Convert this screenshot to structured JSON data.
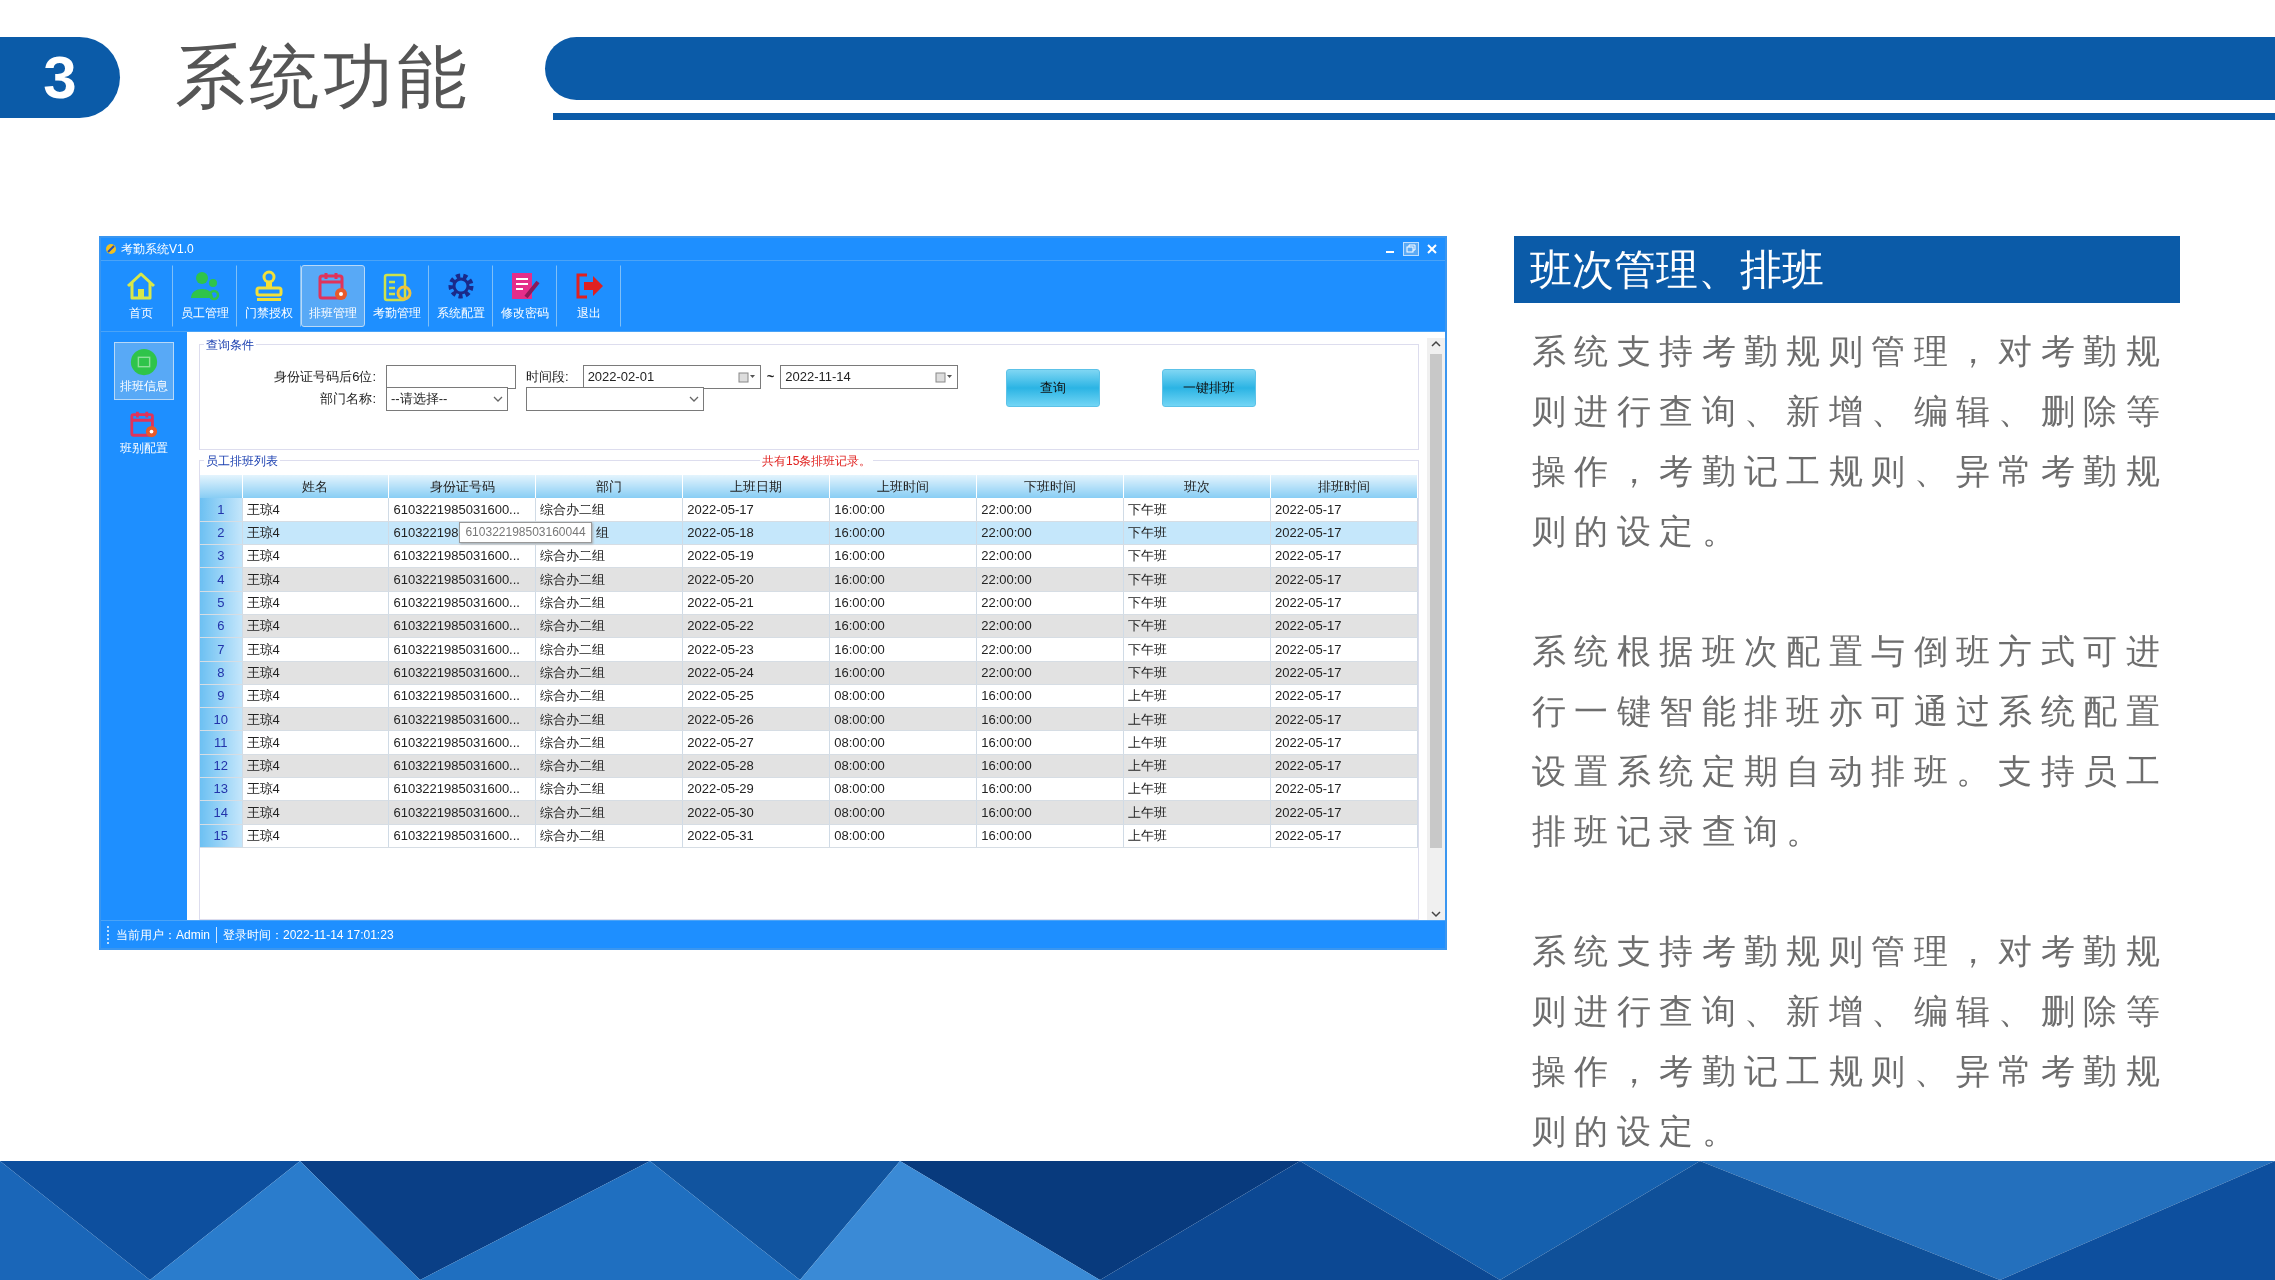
{
  "slide": {
    "number": "3",
    "title": "系统功能"
  },
  "window": {
    "title": "考勤系统V1.0"
  },
  "toolbar": [
    {
      "label": "首页",
      "kind": "house",
      "selected": false
    },
    {
      "label": "员工管理",
      "kind": "people",
      "selected": false
    },
    {
      "label": "门禁授权",
      "kind": "stamp",
      "selected": false
    },
    {
      "label": "排班管理",
      "kind": "calendar",
      "selected": true
    },
    {
      "label": "考勤管理",
      "kind": "clipboard",
      "selected": false
    },
    {
      "label": "系统配置",
      "kind": "gear",
      "selected": false
    },
    {
      "label": "修改密码",
      "kind": "document",
      "selected": false
    },
    {
      "label": "退出",
      "kind": "exit",
      "selected": false
    }
  ],
  "sidebar": [
    {
      "label": "排班信息",
      "kind": "circle",
      "selected": true
    },
    {
      "label": "班别配置",
      "kind": "calendar",
      "selected": false
    }
  ],
  "query": {
    "title": "查询条件",
    "id_label": "身份证号码后6位:",
    "period_label": "时间段:",
    "start_date": "2022-02-01",
    "separator": "~",
    "end_date": "2022-11-14",
    "dept_label": "部门名称:",
    "dept_select": "--请选择--",
    "buttons": [
      "查询",
      "一键排班"
    ]
  },
  "list": {
    "title": "员工排班列表",
    "count": "共有15条排班记录。",
    "columns": [
      "姓名",
      "身份证号码",
      "部门",
      "上班日期",
      "上班时间",
      "下班时间",
      "班次",
      "排班时间"
    ],
    "rows": [
      {
        "no": "1",
        "selected": false,
        "cells": [
          "王琼4",
          "6103221985031600...",
          "综合办二组",
          "2022-05-17",
          "16:00:00",
          "22:00:00",
          "下午班",
          "2022-05-17"
        ]
      },
      {
        "no": "2",
        "selected": true,
        "tooltip": "610322198503160044",
        "cells": [
          "王琼4",
          "610322198",
          "组",
          "2022-05-18",
          "16:00:00",
          "22:00:00",
          "下午班",
          "2022-05-17"
        ]
      },
      {
        "no": "3",
        "selected": false,
        "cells": [
          "王琼4",
          "6103221985031600...",
          "综合办二组",
          "2022-05-19",
          "16:00:00",
          "22:00:00",
          "下午班",
          "2022-05-17"
        ]
      },
      {
        "no": "4",
        "selected": false,
        "cells": [
          "王琼4",
          "6103221985031600...",
          "综合办二组",
          "2022-05-20",
          "16:00:00",
          "22:00:00",
          "下午班",
          "2022-05-17"
        ]
      },
      {
        "no": "5",
        "selected": false,
        "cells": [
          "王琼4",
          "6103221985031600...",
          "综合办二组",
          "2022-05-21",
          "16:00:00",
          "22:00:00",
          "下午班",
          "2022-05-17"
        ]
      },
      {
        "no": "6",
        "selected": false,
        "cells": [
          "王琼4",
          "6103221985031600...",
          "综合办二组",
          "2022-05-22",
          "16:00:00",
          "22:00:00",
          "下午班",
          "2022-05-17"
        ]
      },
      {
        "no": "7",
        "selected": false,
        "cells": [
          "王琼4",
          "6103221985031600...",
          "综合办二组",
          "2022-05-23",
          "16:00:00",
          "22:00:00",
          "下午班",
          "2022-05-17"
        ]
      },
      {
        "no": "8",
        "selected": false,
        "cells": [
          "王琼4",
          "6103221985031600...",
          "综合办二组",
          "2022-05-24",
          "16:00:00",
          "22:00:00",
          "下午班",
          "2022-05-17"
        ]
      },
      {
        "no": "9",
        "selected": false,
        "cells": [
          "王琼4",
          "6103221985031600...",
          "综合办二组",
          "2022-05-25",
          "08:00:00",
          "16:00:00",
          "上午班",
          "2022-05-17"
        ]
      },
      {
        "no": "10",
        "selected": false,
        "cells": [
          "王琼4",
          "6103221985031600...",
          "综合办二组",
          "2022-05-26",
          "08:00:00",
          "16:00:00",
          "上午班",
          "2022-05-17"
        ]
      },
      {
        "no": "11",
        "selected": false,
        "cells": [
          "王琼4",
          "6103221985031600...",
          "综合办二组",
          "2022-05-27",
          "08:00:00",
          "16:00:00",
          "上午班",
          "2022-05-17"
        ]
      },
      {
        "no": "12",
        "selected": false,
        "cells": [
          "王琼4",
          "6103221985031600...",
          "综合办二组",
          "2022-05-28",
          "08:00:00",
          "16:00:00",
          "上午班",
          "2022-05-17"
        ]
      },
      {
        "no": "13",
        "selected": false,
        "cells": [
          "王琼4",
          "6103221985031600...",
          "综合办二组",
          "2022-05-29",
          "08:00:00",
          "16:00:00",
          "上午班",
          "2022-05-17"
        ]
      },
      {
        "no": "14",
        "selected": false,
        "cells": [
          "王琼4",
          "6103221985031600...",
          "综合办二组",
          "2022-05-30",
          "08:00:00",
          "16:00:00",
          "上午班",
          "2022-05-17"
        ]
      },
      {
        "no": "15",
        "selected": false,
        "cells": [
          "王琼4",
          "6103221985031600...",
          "综合办二组",
          "2022-05-31",
          "08:00:00",
          "16:00:00",
          "上午班",
          "2022-05-17"
        ]
      }
    ]
  },
  "status_bar": {
    "user": "当前用户：Admin",
    "login": "登录时间：2022-11-14 17:01:23"
  },
  "panel": {
    "heading": "班次管理、排班",
    "paragraphs": [
      "系统支持考勤规则管理，对考勤规则进行查询、新增、编辑、删除等操作，考勤记工规则、异常考勤规则的设定。",
      "系统根据班次配置与倒班方式可进行一键智能排班亦可通过系统配置设置系统定期自动排班。支持员工排班记录查询。",
      "系统支持考勤规则管理，对考勤规则进行查询、新增、编辑、删除等操作，考勤记工规则、异常考勤规则的设定。"
    ]
  }
}
